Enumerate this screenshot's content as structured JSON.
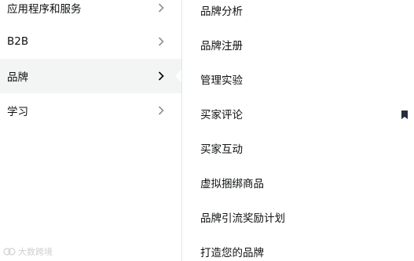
{
  "left_menu": {
    "items": [
      {
        "label": "应用程序和服务",
        "active": false
      },
      {
        "label": "B2B",
        "active": false
      },
      {
        "label": "品牌",
        "active": true
      },
      {
        "label": "学习",
        "active": false
      }
    ]
  },
  "right_menu": {
    "items": [
      {
        "label": "品牌分析"
      },
      {
        "label": "品牌注册"
      },
      {
        "label": "管理实验"
      },
      {
        "label": "买家评论"
      },
      {
        "label": "买家互动"
      },
      {
        "label": "虚拟捆绑商品"
      },
      {
        "label": "品牌引流奖励计划"
      },
      {
        "label": "打造您的品牌"
      }
    ]
  },
  "watermark": {
    "text": "大数跨境"
  },
  "colors": {
    "active_bg": "#f3f4f4",
    "divider": "#e3e6e6",
    "chevron_inactive": "#8d9096",
    "chevron_active": "#0f1111",
    "text": "#0f1111"
  }
}
